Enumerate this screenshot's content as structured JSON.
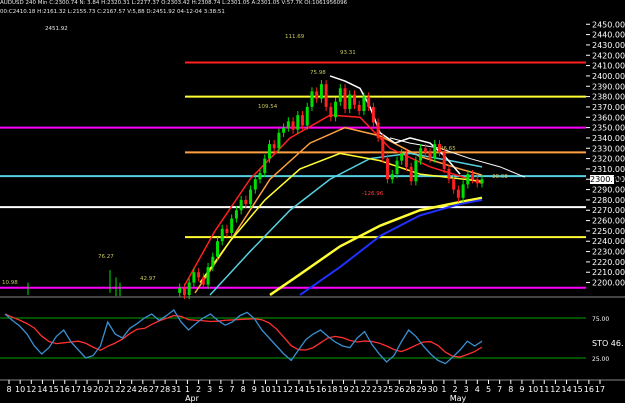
{
  "header": {
    "line1": "AUDUSD 240 Min  C:2300.74  N:  3.84  H:2320.31  L:2277.37  O:2303.42  H:2308.74  L:2301.05  A:2301.05  V:57.7K  OI:1061956096",
    "line2": "00:C2410.18 H:2161.32 L:2155.73 C:2167.57 V:5,88  D:2451.92  04-12-04  3:38:51",
    "value_left": "2451.92"
  },
  "current_price_label": "2300.74",
  "indicator_label": "STO  46.",
  "colors": {
    "background": "#000000",
    "candle": "#00e000",
    "red_line": "#ff2020",
    "yellow": "#ffff33",
    "magenta": "#ff00ff",
    "white": "#ffffff",
    "cyan": "#55d0e0",
    "blue": "#2030ff",
    "orange": "#ffa040",
    "stoch_blue": "#3a8fd0",
    "stoch_red": "#ff3030"
  },
  "chart_data": {
    "type": "candlestick",
    "price_axis": {
      "ticks": [
        "2450.00",
        "2440.00",
        "2430.00",
        "2420.00",
        "2410.00",
        "2400.00",
        "2390.00",
        "2380.00",
        "2370.00",
        "2360.00",
        "2350.00",
        "2340.00",
        "2330.00",
        "2320.00",
        "2310.00",
        "2300.00",
        "2290.00",
        "2280.00",
        "2270.00",
        "2260.00",
        "2250.00",
        "2240.00",
        "2230.00",
        "2220.00",
        "2210.00",
        "2200.00"
      ],
      "min": 2187,
      "max": 2458
    },
    "date_axis": {
      "ticks": [
        "8",
        "10",
        "12",
        "14",
        "15",
        "16",
        "17",
        "19",
        "20",
        "21",
        "22",
        "24",
        "26",
        "27",
        "28",
        "31",
        "1",
        "2",
        "3",
        "5",
        "7",
        "8",
        "9",
        "10",
        "11",
        "12",
        "14",
        "15",
        "16",
        "18",
        "19",
        "21",
        "22",
        "23",
        "25",
        "26",
        "28",
        "29",
        "30",
        "1",
        "2",
        "3",
        "4",
        "5",
        "7",
        "8",
        "9",
        "10",
        "11",
        "12",
        "14",
        "15",
        "16",
        "17"
      ],
      "months": [
        "Apr",
        "May"
      ]
    },
    "horizontal_levels": [
      {
        "price": 2413,
        "color": "red_line"
      },
      {
        "price": 2380,
        "color": "yellow"
      },
      {
        "price": 2350,
        "color": "magenta"
      },
      {
        "price": 2326,
        "color": "orange"
      },
      {
        "price": 2303,
        "color": "cyan"
      },
      {
        "price": 2273,
        "color": "white"
      },
      {
        "price": 2244,
        "color": "yellow"
      },
      {
        "price": 2195,
        "color": "magenta"
      }
    ],
    "price_annotations": [
      "2451.92",
      "111.69",
      "93.31",
      "75.98",
      "109.54",
      "76.27",
      "42.97",
      "10.98",
      "-126.96",
      "46.65",
      "30.08"
    ],
    "stochastic": {
      "label": "STO",
      "value": 46,
      "levels": [
        75,
        25
      ]
    }
  }
}
